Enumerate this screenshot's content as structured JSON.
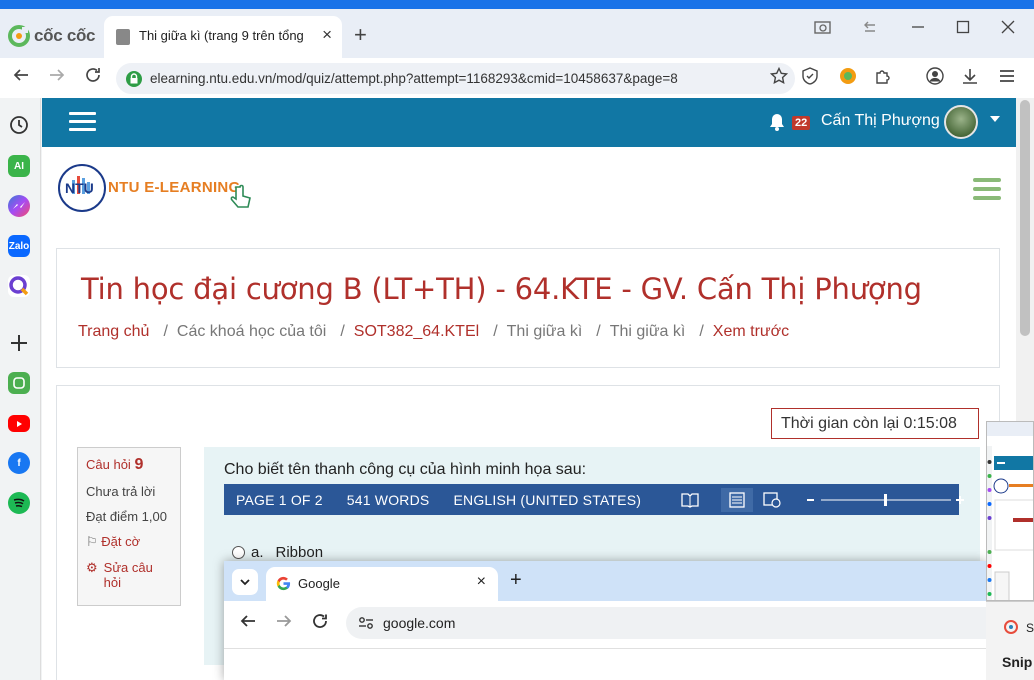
{
  "browser": {
    "brand": "cốc cốc",
    "tab_title": "Thi giữa kì (trang 9 trên tổng",
    "url": "elearning.ntu.edu.vn/mod/quiz/attempt.php?attempt=1168293&cmid=10458637&page=8"
  },
  "moodle": {
    "notification_count": "22",
    "username": "Cấn Thị Phượng",
    "logo_text": "NTU E-LEARNING",
    "logo_mark": "NTU"
  },
  "course": {
    "title": "Tin học đại cương B (LT+TH) - 64.KTE - GV. Cấn Thị Phượng",
    "breadcrumb": [
      "Trang chủ",
      "Các khoá học của tôi",
      "SOT382_64.KTEl",
      "Thi giữa kì",
      "Thi giữa kì",
      "Xem trước"
    ]
  },
  "quiz": {
    "timer": "Thời gian còn lại 0:15:08",
    "question_label": "Câu hỏi",
    "question_number": "9",
    "status": "Chưa trả lời",
    "points": "Đạt điểm 1,00",
    "flag": "Đặt cờ",
    "edit": "Sửa câu hỏi",
    "question_text": "Cho biết tên thanh công cụ của hình minh họa sau:",
    "statusbar": {
      "page": "PAGE 1 OF 2",
      "words": "541 WORDS",
      "language": "ENGLISH (UNITED STATES)"
    },
    "option_a_letter": "a.",
    "option_a_text": "Ribbon"
  },
  "popup": {
    "tab_title": "Google",
    "url": "google.com"
  },
  "snip": {
    "short": "Sn",
    "title": "Snip"
  }
}
